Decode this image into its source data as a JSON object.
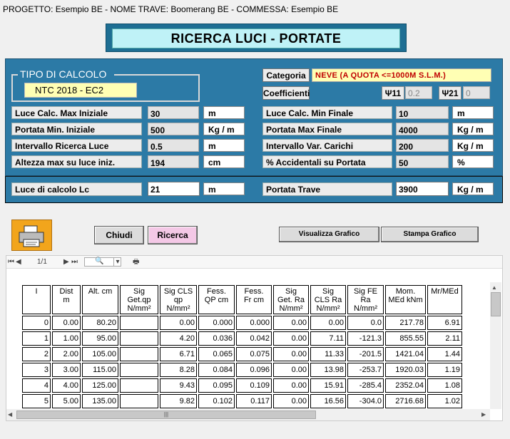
{
  "header": {
    "project_line": "PROGETTO: Esempio BE - NOME TRAVE: Boomerang BE - COMMESSA: Esempio BE",
    "title": "RICERCA LUCI - PORTATE"
  },
  "tipo_calcolo": {
    "label": "TIPO DI CALCOLO",
    "value": "NTC 2018 - EC2"
  },
  "categoria": {
    "label": "Categoria",
    "value": "NEVE (A QUOTA <=1000M S.L.M.)",
    "coeff_label": "Coefficienti",
    "psi11_label": "Ψ11",
    "psi11_value": "0.2",
    "psi21_label": "Ψ21",
    "psi21_value": "0"
  },
  "left_fields": [
    {
      "label": "Luce Calc. Max Iniziale",
      "value": "30",
      "unit": "m"
    },
    {
      "label": "Portata Min. Iniziale",
      "value": "500",
      "unit": "Kg / m"
    },
    {
      "label": "Intervallo Ricerca Luce",
      "value": "0.5",
      "unit": "m"
    },
    {
      "label": "Altezza max su luce  iniz.",
      "value": "194",
      "unit": "cm"
    }
  ],
  "right_fields": [
    {
      "label": "Luce Calc. Min Finale",
      "value": "10",
      "unit": "m"
    },
    {
      "label": "Portata Max Finale",
      "value": "4000",
      "unit": "Kg / m"
    },
    {
      "label": "Intervallo Var. Carichi",
      "value": "200",
      "unit": "Kg / m"
    },
    {
      "label": "% Accidentali su Portata",
      "value": "50",
      "unit": "%"
    }
  ],
  "result": {
    "luce_label": "Luce di calcolo  Lc",
    "luce_value": "21",
    "luce_unit": "m",
    "portata_label": "Portata Trave",
    "portata_value": "3900",
    "portata_unit": "Kg / m"
  },
  "buttons": {
    "chiudi": "Chiudi",
    "ricerca": "Ricerca",
    "visualizza": "Visualizza Grafico",
    "stampa": "Stampa Grafico"
  },
  "report_toolbar": {
    "page": "1/1"
  },
  "table": {
    "headers": [
      [
        "I"
      ],
      [
        "Dist",
        "m"
      ],
      [
        "Alt.  cm"
      ],
      [
        "Sig",
        "Get.qp",
        "N/mm²"
      ],
      [
        "Sig CLS",
        "qp",
        "N/mm²"
      ],
      [
        "Fess.",
        "QP cm"
      ],
      [
        "Fess.",
        "Fr cm"
      ],
      [
        "Sig",
        "Get. Ra",
        "N/mm²"
      ],
      [
        "Sig",
        "CLS Ra",
        "N/mm²"
      ],
      [
        "Sig FE",
        "Ra",
        "N/mm²"
      ],
      [
        "Mom.",
        "MEd kNm"
      ],
      [
        "Mr/MEd"
      ]
    ],
    "rows": [
      [
        "0",
        "0.00",
        "80.20",
        "",
        "0.00",
        "0.000",
        "0.000",
        "0.00",
        "0.00",
        "0.0",
        "217.78",
        "6.91"
      ],
      [
        "1",
        "1.00",
        "95.00",
        "",
        "4.20",
        "0.036",
        "0.042",
        "0.00",
        "7.11",
        "-121.3",
        "855.55",
        "2.11"
      ],
      [
        "2",
        "2.00",
        "105.00",
        "",
        "6.71",
        "0.065",
        "0.075",
        "0.00",
        "11.33",
        "-201.5",
        "1421.04",
        "1.44"
      ],
      [
        "3",
        "3.00",
        "115.00",
        "",
        "8.28",
        "0.084",
        "0.096",
        "0.00",
        "13.98",
        "-253.7",
        "1920.03",
        "1.19"
      ],
      [
        "4",
        "4.00",
        "125.00",
        "",
        "9.43",
        "0.095",
        "0.109",
        "0.00",
        "15.91",
        "-285.4",
        "2352.04",
        "1.08"
      ],
      [
        "5",
        "5.00",
        "135.00",
        "",
        "9.82",
        "0.102",
        "0.117",
        "0.00",
        "16.56",
        "-304.0",
        "2716.68",
        "1.02"
      ]
    ]
  }
}
